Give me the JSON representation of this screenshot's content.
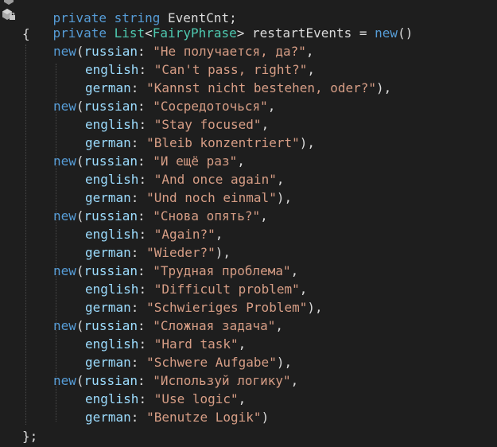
{
  "editor": {
    "top_cut": {
      "kw": "private",
      "type": "string",
      "text": " EventCnt;"
    },
    "decl": {
      "kw_private": "private",
      "type_list": "List",
      "lt": "<",
      "type_arg": "FairyPhrase",
      "gt": ">",
      "name": " restartEvents = ",
      "kw_new": "new",
      "parens": "()"
    },
    "open_brace": "{",
    "close_brace": "};",
    "param_names": {
      "russian": "russian",
      "english": "english",
      "german": "german"
    },
    "entries": [
      {
        "russian": "\"Не получается, да?\"",
        "english": "\"Can't pass, right?\"",
        "german": "\"Kannst nicht bestehen, oder?\"",
        "end": "),"
      },
      {
        "russian": "\"Сосредоточься\"",
        "english": "\"Stay focused\"",
        "german": "\"Bleib konzentriert\"",
        "end": "),"
      },
      {
        "russian": "\"И ещё раз\"",
        "english": "\"And once again\"",
        "german": "\"Und noch einmal\"",
        "end": "),"
      },
      {
        "russian": "\"Снова опять?\"",
        "english": "\"Again?\"",
        "german": "\"Wieder?\"",
        "end": "),"
      },
      {
        "russian": "\"Трудная проблема\"",
        "english": "\"Difficult problem\"",
        "german": "\"Schwieriges Problem\"",
        "end": "),"
      },
      {
        "russian": "\"Сложная задача\"",
        "english": "\"Hard task\"",
        "german": "\"Schwere Aufgabe\"",
        "end": "),"
      },
      {
        "russian": "\"Используй логику\"",
        "english": "\"Use logic\"",
        "german": "\"Benutze Logik\"",
        "end": ")"
      }
    ],
    "colors": {
      "background": "#1e1e1e",
      "keyword": "#569cd6",
      "type": "#4ec9b0",
      "parameter": "#9cdcfe",
      "string": "#d69d85",
      "plain": "#dcdcdc"
    }
  }
}
